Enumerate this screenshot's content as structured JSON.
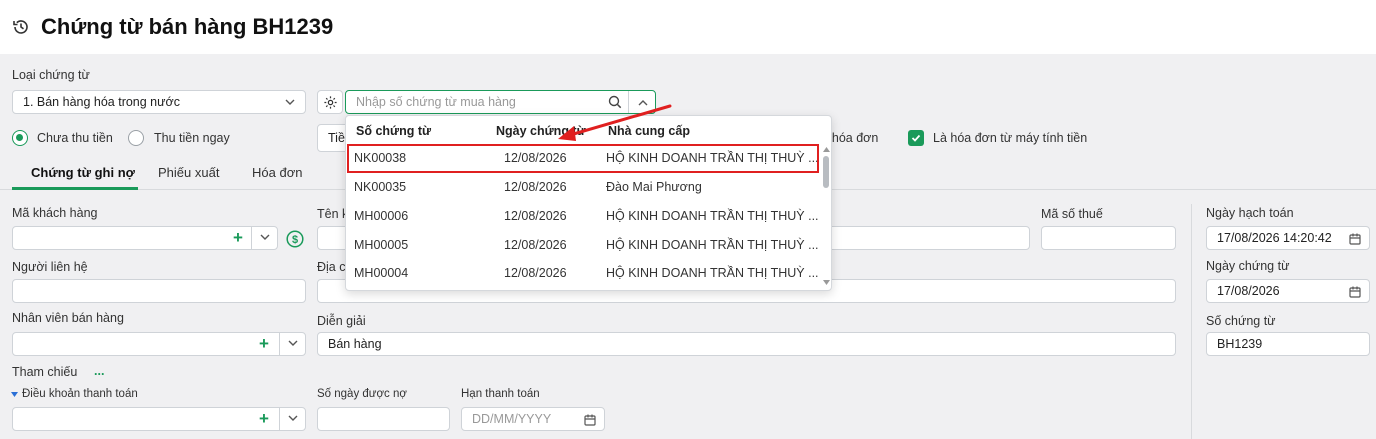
{
  "page": {
    "title": "Chứng từ bán hàng BH1239"
  },
  "loai_chung_tu": {
    "label": "Loại chứng từ",
    "value": "1. Bán hàng hóa trong nước"
  },
  "search": {
    "placeholder": "Nhập số chứng từ mua hàng"
  },
  "payment": {
    "option1": "Chưa thu tiền",
    "option2": "Thu tiền ngay",
    "partial_btn": "Tiề",
    "option1_selected": true
  },
  "invoice": {
    "partial_label": "m hóa đơn",
    "cash_register_label": "Là hóa đơn từ máy tính tiền",
    "cash_register_checked": true
  },
  "tabs": [
    {
      "label": "Chứng từ ghi nợ",
      "active": true
    },
    {
      "label": "Phiếu xuất",
      "active": false
    },
    {
      "label": "Hóa đơn",
      "active": false
    }
  ],
  "form": {
    "ma_khach_hang": "Mã khách hàng",
    "ten_kh_partial": "Tên k",
    "ma_so_thue": "Mã số thuế",
    "nguoi_lien_he": "Người liên hệ",
    "dia_chi_partial": "Địa c",
    "nhan_vien": "Nhân viên bán hàng",
    "dien_giai": {
      "label": "Diễn giải",
      "value": "Bán hàng"
    },
    "tham_chieu": "Tham chiếu",
    "tham_chieu_more": "...",
    "dieu_khoan": "Điều khoản thanh toán",
    "so_ngay": "Số ngày được nợ",
    "han_thanh_toan": {
      "label": "Hạn thanh toán",
      "placeholder": "DD/MM/YYYY"
    }
  },
  "right_panel": {
    "ngay_hach_toan": {
      "label": "Ngày hạch toán",
      "value": "17/08/2026 14:20:42"
    },
    "ngay_chung_tu": {
      "label": "Ngày chứng từ",
      "value": "17/08/2026"
    },
    "so_chung_tu": {
      "label": "Số chứng từ",
      "value": "BH1239"
    }
  },
  "dropdown": {
    "headers": [
      "Số chứng từ",
      "Ngày chứng từ",
      "Nhà cung cấp"
    ],
    "rows": [
      {
        "so": "NK00038",
        "ngay": "12/08/2026",
        "ncc": "HỘ KINH DOANH TRẦN THỊ THUỲ ...",
        "highlighted": true
      },
      {
        "so": "NK00035",
        "ngay": "12/08/2026",
        "ncc": "Đào Mai Phương",
        "highlighted": false
      },
      {
        "so": "MH00006",
        "ngay": "12/08/2026",
        "ncc": "HỘ KINH DOANH TRẦN THỊ THUỲ ...",
        "highlighted": false
      },
      {
        "so": "MH00005",
        "ngay": "12/08/2026",
        "ncc": "HỘ KINH DOANH TRẦN THỊ THUỲ ...",
        "highlighted": false
      },
      {
        "so": "MH00004",
        "ngay": "12/08/2026",
        "ncc": "HỘ KINH DOANH TRẦN THỊ THUỲ ...",
        "highlighted": false
      }
    ]
  },
  "colors": {
    "accent": "#1a9a5a",
    "highlight_box": "#e02020",
    "arrow": "#e02020"
  }
}
